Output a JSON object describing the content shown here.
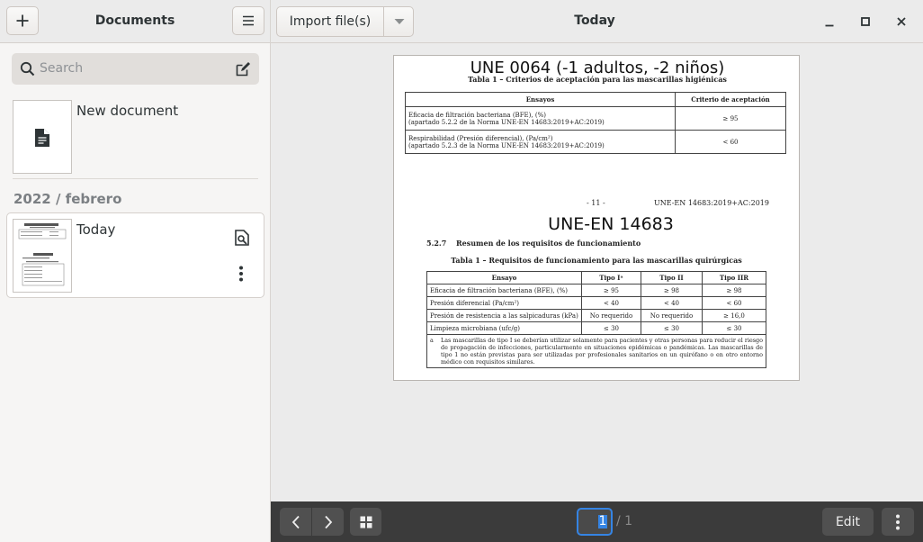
{
  "left": {
    "title": "Documents",
    "search_placeholder": "Search",
    "new_document_label": "New document",
    "section_label": "2022 / febrero",
    "documents": [
      {
        "title": "Today"
      }
    ]
  },
  "toolbar": {
    "import_label": "Import file(s)",
    "window_title": "Today"
  },
  "page": {
    "header_title": "UNE 0064 (-1 adultos, -2 niños)",
    "table1_caption": "Tabla 1 – Criterios de aceptación para las mascarillas higiénicas",
    "table1": {
      "headers": [
        "Ensayos",
        "Criterio de aceptación"
      ],
      "rows": [
        {
          "line1": "Eficacia de filtración bacteriana (BFE), (%)",
          "line2": "(apartado 5.2.2 de la Norma UNE-EN 14683:2019+AC:2019)",
          "value": "≥ 95"
        },
        {
          "line1": "Respirabilidad (Presión diferencial), (Pa/cm²)",
          "line2": "(apartado 5.2.3 de la Norma UNE-EN 14683:2019+AC:2019)",
          "value": "< 60"
        }
      ]
    },
    "page_number": "- 11 -",
    "norm_ref": "UNE-EN 14683:2019+AC:2019",
    "second_title": "UNE-EN 14683",
    "section_num": "5.2.7",
    "section_title": "Resumen de los requisitos de funcionamiento",
    "table2_caption": "Tabla 1 – Requisitos de funcionamiento para las mascarillas quirúrgicas",
    "table2": {
      "headers": [
        "Ensayo",
        "Tipo Iᵃ",
        "Tipo II",
        "Tipo IIR"
      ],
      "rows": [
        [
          "Eficacia de filtración bacteriana (BFE), (%)",
          "≥ 95",
          "≥ 98",
          "≥ 98"
        ],
        [
          "Presión diferencial (Pa/cm²)",
          "< 40",
          "< 40",
          "< 60"
        ],
        [
          "Presión de resistencia a las salpicaduras (kPa)",
          "No requerido",
          "No requerido",
          "≥ 16,0"
        ],
        [
          "Limpieza microbiana (ufc/g)",
          "≤ 30",
          "≤ 30",
          "≤ 30"
        ]
      ],
      "footnote_marker": "a",
      "footnote": "Las mascarillas de tipo I se deberían utilizar solamente para pacientes y otras personas para reducir el riesgo de propagación de infecciones, particularmente en situaciones epidémicas o pandémicas. Las mascarillas de tipo 1 no están previstas para ser utilizadas por profesionales sanitarios en un quirófano o en otro entorno médico con requisitos similares."
    }
  },
  "bottombar": {
    "current_page": "1",
    "total_pages": "/ 1",
    "edit_label": "Edit"
  },
  "colors": {
    "accent": "#3584e4",
    "bottombar_bg": "#3b3b3b",
    "sidebar_bg": "#f6f5f4"
  }
}
